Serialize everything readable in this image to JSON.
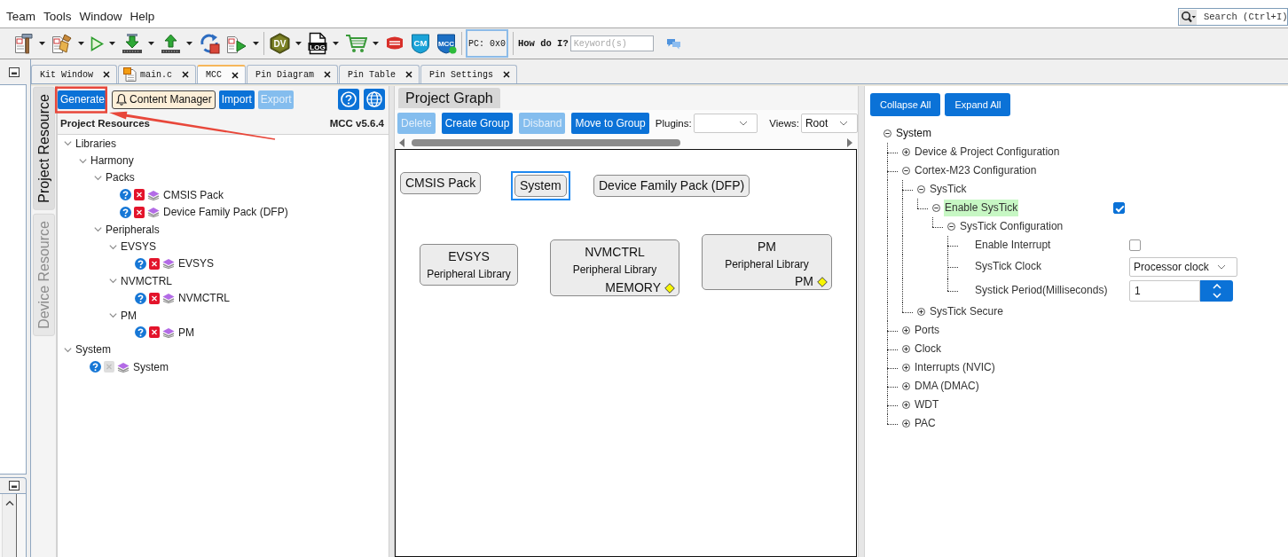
{
  "menu_bar": {
    "items": [
      "Team",
      "Tools",
      "Window",
      "Help"
    ],
    "search_placeholder": "Search (Ctrl+I)"
  },
  "toolbar": {
    "badges": [
      "DV",
      "LOG",
      "CM",
      "MCC"
    ],
    "pc_readout": "PC: 0x0",
    "help_label": "How do I?",
    "keyword_placeholder": "Keyword(s)"
  },
  "editor_tabs": [
    {
      "label": "Kit Window",
      "kind": "window",
      "selected": false
    },
    {
      "label": "main.c",
      "kind": "source",
      "selected": false
    },
    {
      "label": "MCC",
      "kind": "window",
      "selected": true
    },
    {
      "label": "Pin Diagram",
      "kind": "window",
      "selected": false
    },
    {
      "label": "Pin Table",
      "kind": "window",
      "selected": false
    },
    {
      "label": "Pin Settings",
      "kind": "window",
      "selected": false
    }
  ],
  "side_tabs": [
    {
      "label": "Project Resource",
      "selected": true
    },
    {
      "label": "Device Resource",
      "selected": false
    }
  ],
  "resources_panel": {
    "buttons": [
      {
        "label": "Generate",
        "kind": "primary",
        "disabled": false
      },
      {
        "label": "Content Manager",
        "kind": "notice",
        "disabled": false
      },
      {
        "label": "Import",
        "kind": "primary",
        "disabled": false
      },
      {
        "label": "Export",
        "kind": "primary",
        "disabled": true
      }
    ],
    "title": "Project Resources",
    "version": "MCC v5.6.4",
    "tree": [
      {
        "label": "Libraries",
        "kind": "group",
        "expanded": true,
        "children": [
          {
            "label": "Harmony",
            "kind": "group",
            "expanded": true,
            "children": [
              {
                "label": "Packs",
                "kind": "group",
                "expanded": true,
                "children": [
                  {
                    "label": "CMSIS Pack",
                    "kind": "component",
                    "removable": true
                  },
                  {
                    "label": "Device Family Pack (DFP)",
                    "kind": "component",
                    "removable": true
                  }
                ]
              },
              {
                "label": "Peripherals",
                "kind": "group",
                "expanded": true,
                "children": [
                  {
                    "label": "EVSYS",
                    "kind": "group",
                    "expanded": true,
                    "children": [
                      {
                        "label": "EVSYS",
                        "kind": "component",
                        "removable": true
                      }
                    ]
                  },
                  {
                    "label": "NVMCTRL",
                    "kind": "group",
                    "expanded": true,
                    "children": [
                      {
                        "label": "NVMCTRL",
                        "kind": "component",
                        "removable": true
                      }
                    ]
                  },
                  {
                    "label": "PM",
                    "kind": "group",
                    "expanded": true,
                    "children": [
                      {
                        "label": "PM",
                        "kind": "component",
                        "removable": true
                      }
                    ]
                  }
                ]
              }
            ]
          }
        ]
      },
      {
        "label": "System",
        "kind": "group",
        "expanded": true,
        "children": [
          {
            "label": "System",
            "kind": "component",
            "removable": false
          }
        ]
      }
    ]
  },
  "graph_panel": {
    "tab": "Project Graph",
    "buttons": [
      {
        "label": "Delete",
        "disabled": true
      },
      {
        "label": "Create Group",
        "disabled": false
      },
      {
        "label": "Disband",
        "disabled": true
      },
      {
        "label": "Move to Group",
        "disabled": false
      }
    ],
    "plugins_label": "Plugins:",
    "views_label": "Views:",
    "views_value": "Root",
    "nodes": [
      {
        "title": "CMSIS Pack",
        "kind": "pack",
        "selected": false
      },
      {
        "title": "System",
        "kind": "pack",
        "selected": true
      },
      {
        "title": "Device Family Pack (DFP)",
        "kind": "pack",
        "selected": false
      },
      {
        "title": "EVSYS",
        "subtitle": "Peripheral Library",
        "kind": "library",
        "selected": false
      },
      {
        "title": "NVMCTRL",
        "subtitle": "Peripheral Library",
        "port": "MEMORY",
        "kind": "library",
        "selected": false
      },
      {
        "title": "PM",
        "subtitle": "Peripheral Library",
        "port": "PM",
        "kind": "library",
        "selected": false
      }
    ]
  },
  "config_panel": {
    "buttons": [
      "Collapse All",
      "Expand All"
    ],
    "tree": [
      {
        "label": "System",
        "expanded": true,
        "children": [
          {
            "label": "Device & Project Configuration",
            "expanded": false
          },
          {
            "label": "Cortex-M23 Configuration",
            "expanded": true,
            "children": [
              {
                "label": "SysTick",
                "expanded": true,
                "children": [
                  {
                    "label": "Enable SysTick",
                    "expanded": true,
                    "highlighted": true,
                    "kind": "checkbox",
                    "checked": true,
                    "children": [
                      {
                        "label": "SysTick Configuration",
                        "expanded": true,
                        "children": [
                          {
                            "label": "Enable Interrupt",
                            "kind": "checkbox",
                            "checked": false
                          },
                          {
                            "label": "SysTick Clock",
                            "kind": "dropdown",
                            "value": "Processor clock"
                          },
                          {
                            "label": "Systick Period(Milliseconds)",
                            "kind": "spinner",
                            "value": "1"
                          }
                        ]
                      }
                    ]
                  }
                ]
              },
              {
                "label": "SysTick Secure",
                "expanded": false
              }
            ]
          },
          {
            "label": "Ports",
            "expanded": false
          },
          {
            "label": "Clock",
            "expanded": false
          },
          {
            "label": "Interrupts (NVIC)",
            "expanded": false
          },
          {
            "label": "DMA (DMAC)",
            "expanded": false
          },
          {
            "label": "WDT",
            "expanded": false
          },
          {
            "label": "PAC",
            "expanded": false
          }
        ]
      }
    ]
  }
}
